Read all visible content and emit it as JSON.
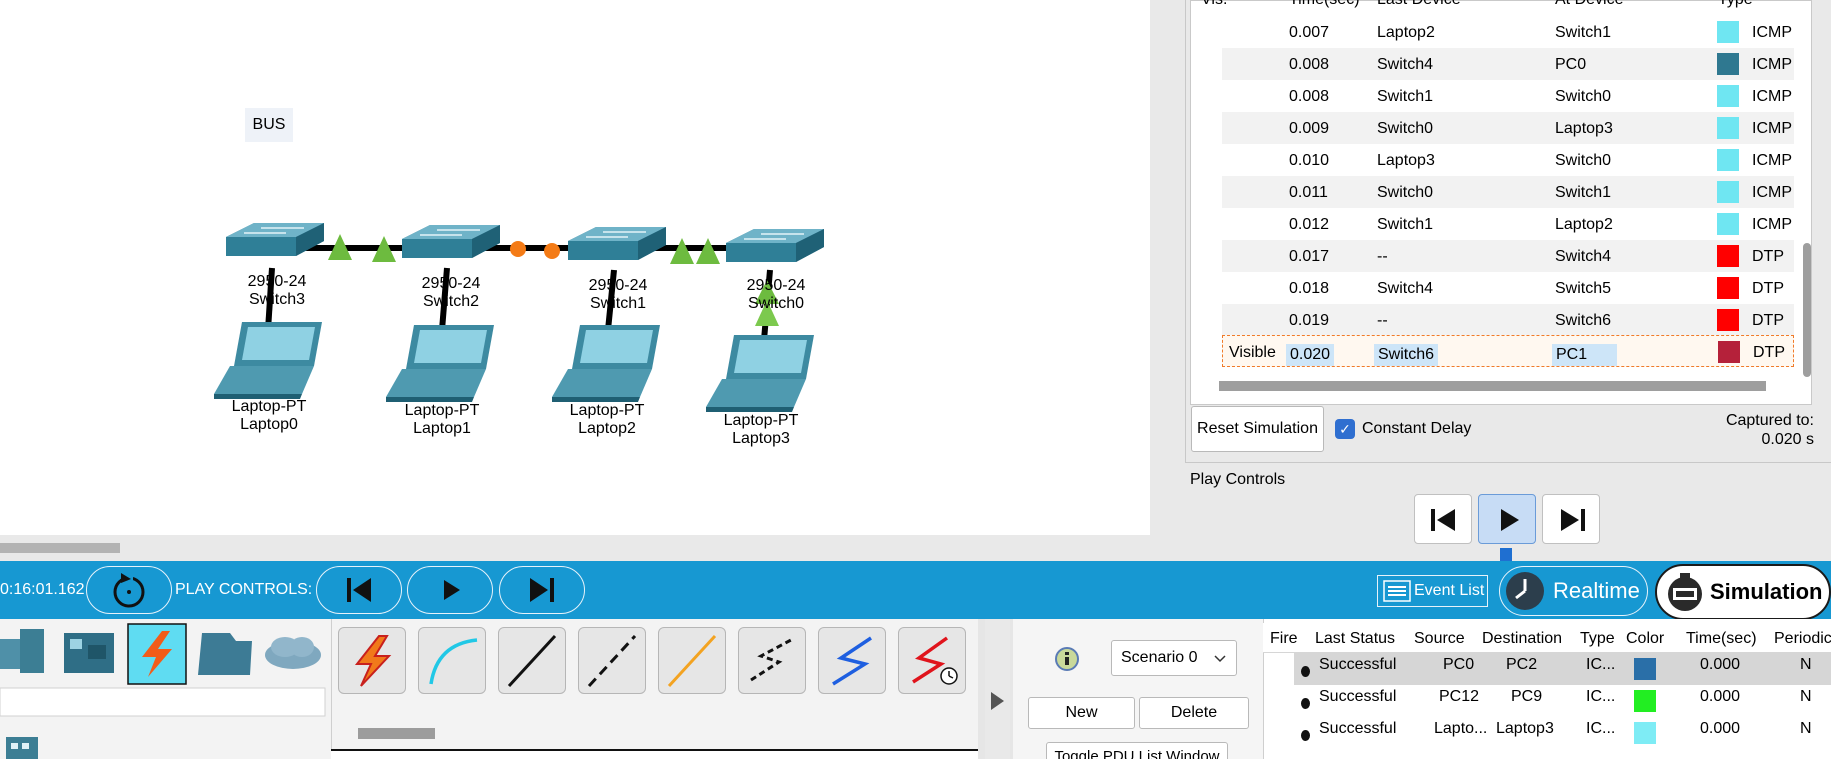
{
  "workspace": {
    "bus_label": "BUS",
    "devices": [
      {
        "model": "2950-24",
        "name": "Switch3"
      },
      {
        "model": "2950-24",
        "name": "Switch2"
      },
      {
        "model": "2950-24",
        "name": "Switch1"
      },
      {
        "model": "2950-24",
        "name": "Switch0"
      },
      {
        "model": "Laptop-PT",
        "name": "Laptop0"
      },
      {
        "model": "Laptop-PT",
        "name": "Laptop1"
      },
      {
        "model": "Laptop-PT",
        "name": "Laptop2"
      },
      {
        "model": "Laptop-PT",
        "name": "Laptop3"
      }
    ]
  },
  "event_list": {
    "headers": {
      "vis": "Vis.",
      "time": "Time(sec)",
      "last": "Last Device",
      "at": "At Device",
      "type": "Type"
    },
    "rows": [
      {
        "vis": "",
        "time": "0.007",
        "last": "Laptop2",
        "at": "Switch1",
        "color": "#6fe6f2",
        "type": "ICMP"
      },
      {
        "vis": "",
        "time": "0.008",
        "last": "Switch4",
        "at": "PC0",
        "color": "#2f7890",
        "type": "ICMP"
      },
      {
        "vis": "",
        "time": "0.008",
        "last": "Switch1",
        "at": "Switch0",
        "color": "#6fe6f2",
        "type": "ICMP"
      },
      {
        "vis": "",
        "time": "0.009",
        "last": "Switch0",
        "at": "Laptop3",
        "color": "#6fe6f2",
        "type": "ICMP"
      },
      {
        "vis": "",
        "time": "0.010",
        "last": "Laptop3",
        "at": "Switch0",
        "color": "#6fe6f2",
        "type": "ICMP"
      },
      {
        "vis": "",
        "time": "0.011",
        "last": "Switch0",
        "at": "Switch1",
        "color": "#6fe6f2",
        "type": "ICMP"
      },
      {
        "vis": "",
        "time": "0.012",
        "last": "Switch1",
        "at": "Laptop2",
        "color": "#6fe6f2",
        "type": "ICMP"
      },
      {
        "vis": "",
        "time": "0.017",
        "last": "--",
        "at": "Switch4",
        "color": "#ff0000",
        "type": "DTP"
      },
      {
        "vis": "",
        "time": "0.018",
        "last": "Switch4",
        "at": "Switch5",
        "color": "#ff0000",
        "type": "DTP"
      },
      {
        "vis": "",
        "time": "0.019",
        "last": "--",
        "at": "Switch6",
        "color": "#ff0000",
        "type": "DTP"
      },
      {
        "vis": "Visible",
        "time": "0.020",
        "last": "Switch6",
        "at": "PC1",
        "color": "#b5213a",
        "type": "DTP"
      }
    ]
  },
  "sim_controls": {
    "reset_label": "Reset Simulation",
    "constant_delay_label": "Constant Delay",
    "constant_delay_checked": true,
    "captured_label": "Captured to:",
    "captured_value": "0.020 s",
    "play_controls_title": "Play Controls"
  },
  "toolbar": {
    "clock": "0:16:01.162",
    "play_controls_label": "PLAY CONTROLS:",
    "event_list_label": "Event List",
    "realtime_label": "Realtime",
    "simulation_label": "Simulation",
    "accent": "#1798d2"
  },
  "scenario": {
    "selected": "Scenario 0",
    "new_label": "New",
    "delete_label": "Delete",
    "toggle_label": "Toggle PDU List Window"
  },
  "pdu_list": {
    "headers": [
      "Fire",
      "Last Status",
      "Source",
      "Destination",
      "Type",
      "Color",
      "Time(sec)",
      "Periodic"
    ],
    "rows": [
      {
        "status": "Successful",
        "source": "PC0",
        "destination": "PC2",
        "type": "IC...",
        "color": "#2a6fa8",
        "time": "0.000",
        "periodic": "N"
      },
      {
        "status": "Successful",
        "source": "PC12",
        "destination": "PC9",
        "type": "IC...",
        "color": "#22ee22",
        "time": "0.000",
        "periodic": "N"
      },
      {
        "status": "Successful",
        "source": "Lapto...",
        "destination": "Laptop3",
        "type": "IC...",
        "color": "#7eecf5",
        "time": "0.000",
        "periodic": "N"
      }
    ]
  }
}
